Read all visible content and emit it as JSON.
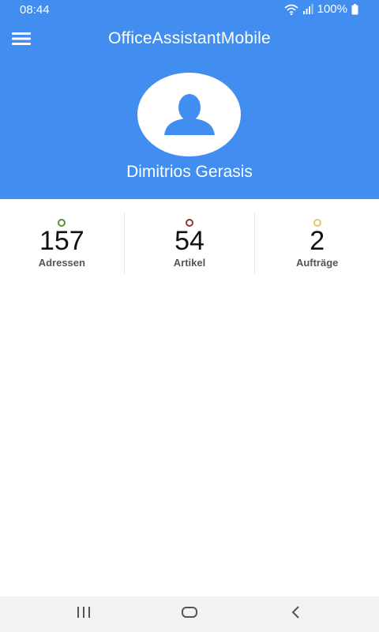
{
  "status_bar": {
    "time": "08:44",
    "battery": "100%"
  },
  "app": {
    "title": "OfficeAssistantMobile"
  },
  "user": {
    "name": "Dimitrios Gerasis"
  },
  "stats": [
    {
      "value": "157",
      "label": "Adressen",
      "dot_color": "#5a8f3c"
    },
    {
      "value": "54",
      "label": "Artikel",
      "dot_color": "#8b3a2b"
    },
    {
      "value": "2",
      "label": "Aufträge",
      "dot_color": "#e3c56b"
    }
  ],
  "colors": {
    "header": "#418ef0",
    "nav_bar": "#f2f2f2"
  }
}
